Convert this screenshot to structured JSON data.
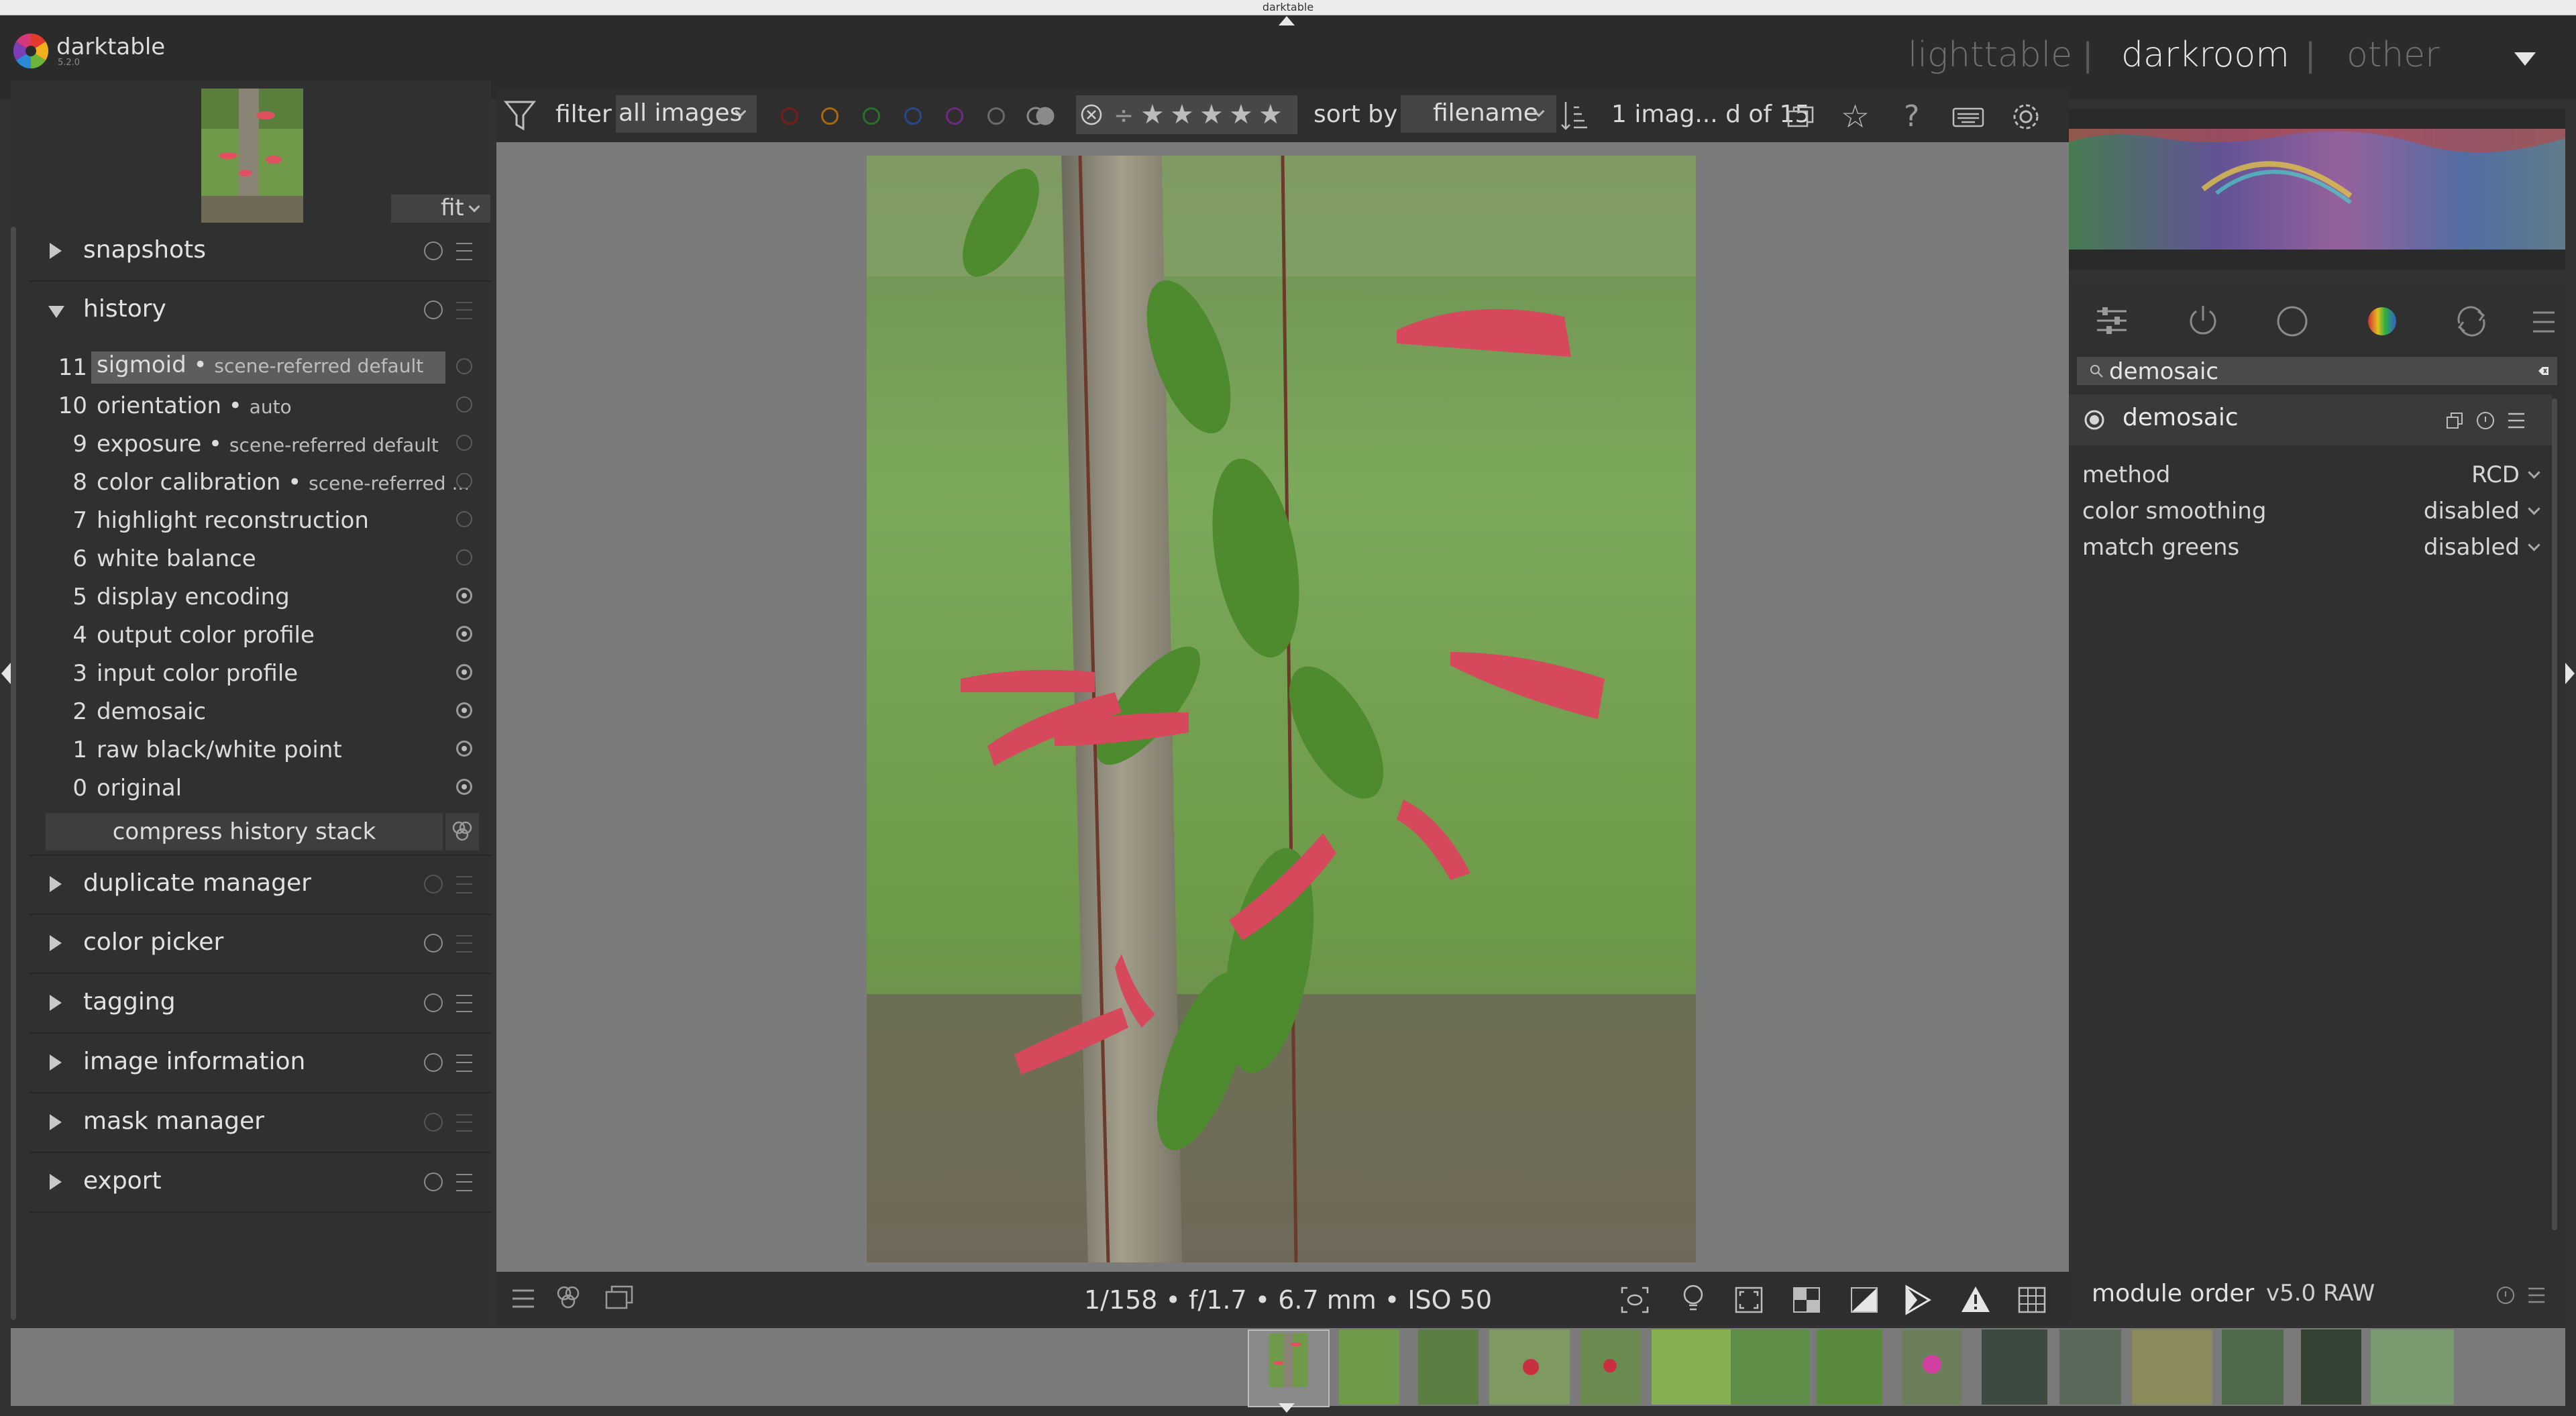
{
  "window": {
    "title": "darktable"
  },
  "header": {
    "app_name": "darktable",
    "version": "5.2.0",
    "views": [
      "lighttable",
      "darkroom",
      "other"
    ],
    "active_view": "darkroom",
    "separator": "|"
  },
  "left_panel": {
    "nav_zoom": "fit",
    "modules": {
      "snapshots": "snapshots",
      "history": "history",
      "duplicate_manager": "duplicate manager",
      "color_picker": "color picker",
      "tagging": "tagging",
      "image_information": "image information",
      "mask_manager": "mask manager",
      "export": "export"
    },
    "history_items": [
      {
        "num": "11",
        "name": "sigmoid",
        "detail": "scene-referred default",
        "selected": true
      },
      {
        "num": "10",
        "name": "orientation",
        "detail": "auto"
      },
      {
        "num": "9",
        "name": "exposure",
        "detail": "scene-referred default"
      },
      {
        "num": "8",
        "name": "color calibration",
        "detail": "scene-referred ..."
      },
      {
        "num": "7",
        "name": "highlight reconstruction",
        "detail": ""
      },
      {
        "num": "6",
        "name": "white balance",
        "detail": ""
      },
      {
        "num": "5",
        "name": "display encoding",
        "detail": ""
      },
      {
        "num": "4",
        "name": "output color profile",
        "detail": ""
      },
      {
        "num": "3",
        "name": "input color profile",
        "detail": ""
      },
      {
        "num": "2",
        "name": "demosaic",
        "detail": ""
      },
      {
        "num": "1",
        "name": "raw black/white point",
        "detail": ""
      },
      {
        "num": "0",
        "name": "original",
        "detail": ""
      }
    ],
    "compress_label": "compress history stack"
  },
  "top_toolbar": {
    "filter_label": "filter",
    "filter_value": "all images",
    "sort_label": "sort by",
    "sort_value": "filename",
    "count_text": "1 imag... d of 15",
    "color_labels": [
      "#8a1e1e",
      "#b06a10",
      "#2f7a2f",
      "#2a4f98",
      "#7a2a8a"
    ]
  },
  "bottom_toolbar": {
    "exif": "1/158 • f/1.7 • 6.7 mm • ISO 50"
  },
  "right_panel": {
    "search_value": "demosaic",
    "module_name": "demosaic",
    "params": [
      {
        "key": "method",
        "value": "RCD"
      },
      {
        "key": "color smoothing",
        "value": "disabled"
      },
      {
        "key": "match greens",
        "value": "disabled"
      }
    ],
    "module_order_label": "module order",
    "module_order_value": "v5.0 RAW"
  }
}
